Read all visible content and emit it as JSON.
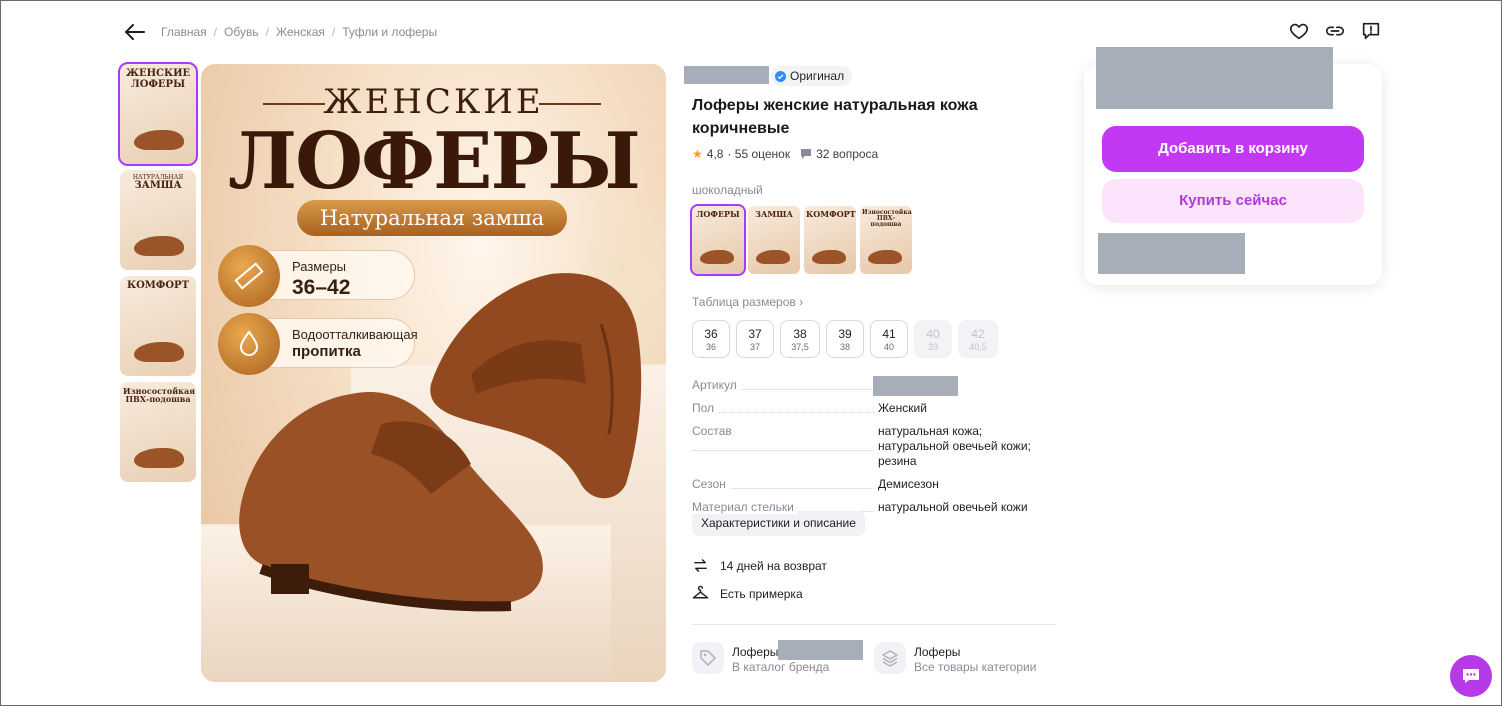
{
  "breadcrumbs": [
    "Главная",
    "Обувь",
    "Женская",
    "Туфли и лоферы"
  ],
  "gallery": {
    "thumbs": [
      {
        "title": "ЖЕНСКИЕ ЛОФЕРЫ",
        "sub": ""
      },
      {
        "title": "ЗАМША",
        "sub": "НАТУРАЛЬНАЯ"
      },
      {
        "title": "КОМФОРТ",
        "sub": ""
      },
      {
        "title": "Износостойкая ПВХ-подошва",
        "sub": ""
      }
    ],
    "hero": {
      "line1": "ЖЕНСКИЕ",
      "line2": "ЛОФЕРЫ",
      "ribbon": "Натуральная замша",
      "badge1_label": "Размеры",
      "badge1_value": "36–42",
      "badge2_label": "Водоотталкивающая",
      "badge2_value": "пропитка"
    }
  },
  "product": {
    "original_badge": "Оригинал",
    "title": "Лоферы женские натуральная кожа коричневые",
    "rating": "4,8",
    "reviews": "· 55 оценок",
    "questions": "32 вопроса",
    "color_name": "шоколадный",
    "variants": [
      "ЛОФЕРЫ",
      "ЗАМША",
      "КОМФОРТ",
      "Износостойкая ПВХ-подошва"
    ],
    "size_table_link": "Таблица размеров ›",
    "sizes": [
      {
        "size": "36",
        "ru": "36",
        "available": true
      },
      {
        "size": "37",
        "ru": "37",
        "available": true
      },
      {
        "size": "38",
        "ru": "37,5",
        "available": true
      },
      {
        "size": "39",
        "ru": "38",
        "available": true
      },
      {
        "size": "41",
        "ru": "40",
        "available": true
      },
      {
        "size": "40",
        "ru": "39",
        "available": false
      },
      {
        "size": "42",
        "ru": "40,5",
        "available": false
      }
    ],
    "specs": [
      {
        "key": "Артикул",
        "value": ""
      },
      {
        "key": "Пол",
        "value": "Женский"
      },
      {
        "key": "Состав",
        "value": "натуральная кожа; натуральной овечьей кожи; резина"
      },
      {
        "key": "Сезон",
        "value": "Демисезон"
      },
      {
        "key": "Материал стельки",
        "value": "натуральной овечьей кожи"
      }
    ],
    "characteristics_button": "Характеристики и описание",
    "return_text": "14 дней на возврат",
    "fitting_text": "Есть примерка",
    "brand_link_title": "Лоферы",
    "brand_link_sub": "В каталог бренда",
    "category_link_title": "Лоферы",
    "category_link_sub": "Все товары категории"
  },
  "buy": {
    "add_to_cart": "Добавить в корзину",
    "buy_now": "Купить сейчас"
  },
  "colors": {
    "accent": "#c139f5",
    "accent_light": "#fbe4fc",
    "redaction": "#a7adb9",
    "star": "#ff9a1f"
  },
  "icons": [
    "back-arrow-icon",
    "heart-icon",
    "link-icon",
    "report-icon",
    "verified-icon",
    "star-icon",
    "question-icon",
    "return-icon",
    "hanger-icon",
    "tag-icon",
    "layers-icon",
    "chat-icon"
  ]
}
